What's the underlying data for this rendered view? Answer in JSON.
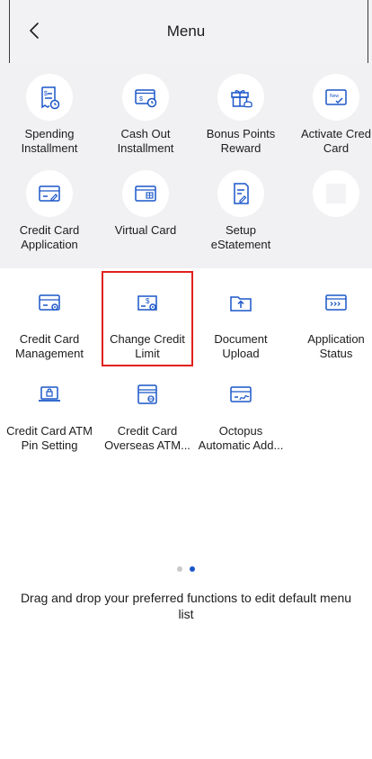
{
  "header": {
    "title": "Menu",
    "back_icon": "chevron-left-icon"
  },
  "colors": {
    "accent": "#1a56c8",
    "highlight": "#e0201c",
    "icon_stroke": "#1a56c8"
  },
  "section_a": {
    "tiles": [
      {
        "label": "Spending\nInstallment",
        "icon": "receipt-clock-icon"
      },
      {
        "label": "Cash Out\nInstallment",
        "icon": "cash-clock-icon"
      },
      {
        "label": "Bonus Points\nReward",
        "icon": "gift-icon"
      },
      {
        "label": "Activate Cred\nCard",
        "icon": "card-new-icon"
      },
      {
        "label": "Credit Card\nApplication",
        "icon": "card-pen-icon"
      },
      {
        "label": "Virtual Card",
        "icon": "virtual-card-icon"
      },
      {
        "label": "Setup\neStatement",
        "icon": "document-pen-icon"
      },
      {
        "label": "",
        "icon": "empty-slot-icon"
      }
    ]
  },
  "section_b": {
    "tiles": [
      {
        "label": "Credit Card\nManagement",
        "icon": "card-gear-icon"
      },
      {
        "label": "Change Credit\nLimit",
        "icon": "limit-gear-icon"
      },
      {
        "label": "Document\nUpload",
        "icon": "folder-upload-icon"
      },
      {
        "label": "Application\nStatus",
        "icon": "card-progress-icon"
      },
      {
        "label": "Credit Card ATM\nPin Setting",
        "icon": "laptop-lock-icon"
      },
      {
        "label": "Credit Card\nOverseas ATM...",
        "icon": "card-globe-icon"
      },
      {
        "label": "Octopus\nAutomatic Add...",
        "icon": "card-sign-icon"
      }
    ]
  },
  "pager": {
    "pages": 2,
    "current": 2
  },
  "hint": "Drag and drop your preferred functions to edit default menu list"
}
